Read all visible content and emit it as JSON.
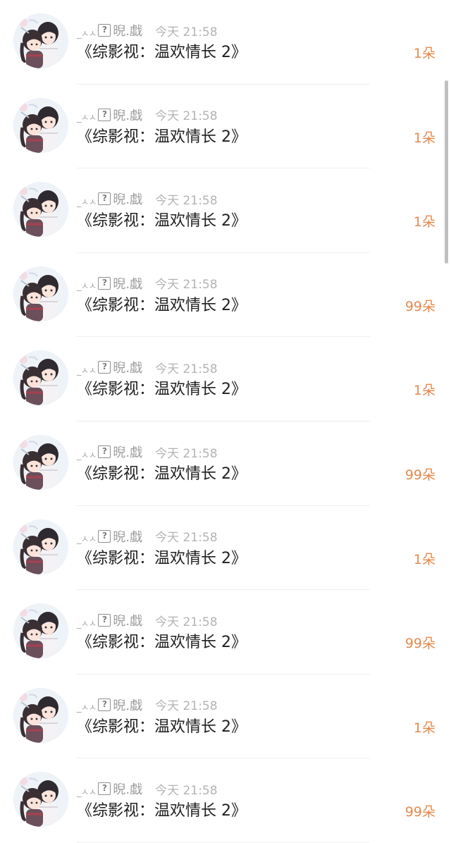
{
  "rows": [
    {
      "nick_prefix": "_ㅅㅅ",
      "nick_suffix": "晲.戱",
      "time": "今天 21:58",
      "title": "《综影视：温欢情长 2》",
      "count": "1朵"
    },
    {
      "nick_prefix": "_ㅅㅅ",
      "nick_suffix": "晲.戱",
      "time": "今天 21:58",
      "title": "《综影视：温欢情长 2》",
      "count": "1朵"
    },
    {
      "nick_prefix": "_ㅅㅅ",
      "nick_suffix": "晲.戱",
      "time": "今天 21:58",
      "title": "《综影视：温欢情长 2》",
      "count": "1朵"
    },
    {
      "nick_prefix": "_ㅅㅅ",
      "nick_suffix": "晲.戱",
      "time": "今天 21:58",
      "title": "《综影视：温欢情长 2》",
      "count": "99朵"
    },
    {
      "nick_prefix": "_ㅅㅅ",
      "nick_suffix": "晲.戱",
      "time": "今天 21:58",
      "title": "《综影视：温欢情长 2》",
      "count": "1朵"
    },
    {
      "nick_prefix": "_ㅅㅅ",
      "nick_suffix": "晲.戱",
      "time": "今天 21:58",
      "title": "《综影视：温欢情长 2》",
      "count": "99朵"
    },
    {
      "nick_prefix": "_ㅅㅅ",
      "nick_suffix": "晲.戱",
      "time": "今天 21:58",
      "title": "《综影视：温欢情长 2》",
      "count": "1朵"
    },
    {
      "nick_prefix": "_ㅅㅅ",
      "nick_suffix": "晲.戱",
      "time": "今天 21:58",
      "title": "《综影视：温欢情长 2》",
      "count": "99朵"
    },
    {
      "nick_prefix": "_ㅅㅅ",
      "nick_suffix": "晲.戱",
      "time": "今天 21:58",
      "title": "《综影视：温欢情长 2》",
      "count": "1朵"
    },
    {
      "nick_prefix": "_ㅅㅅ",
      "nick_suffix": "晲.戱",
      "time": "今天 21:58",
      "title": "《综影视：温欢情长 2》",
      "count": "99朵"
    }
  ],
  "missing_glyph": "?",
  "icons": {
    "avatar": "anime-couple-avatar-icon",
    "missing_glyph": "missing-glyph-icon"
  },
  "colors": {
    "accent": "#e5894b",
    "meta_text": "#9b9b9b",
    "title_text": "#1f1f1f",
    "divider": "#efefef"
  }
}
